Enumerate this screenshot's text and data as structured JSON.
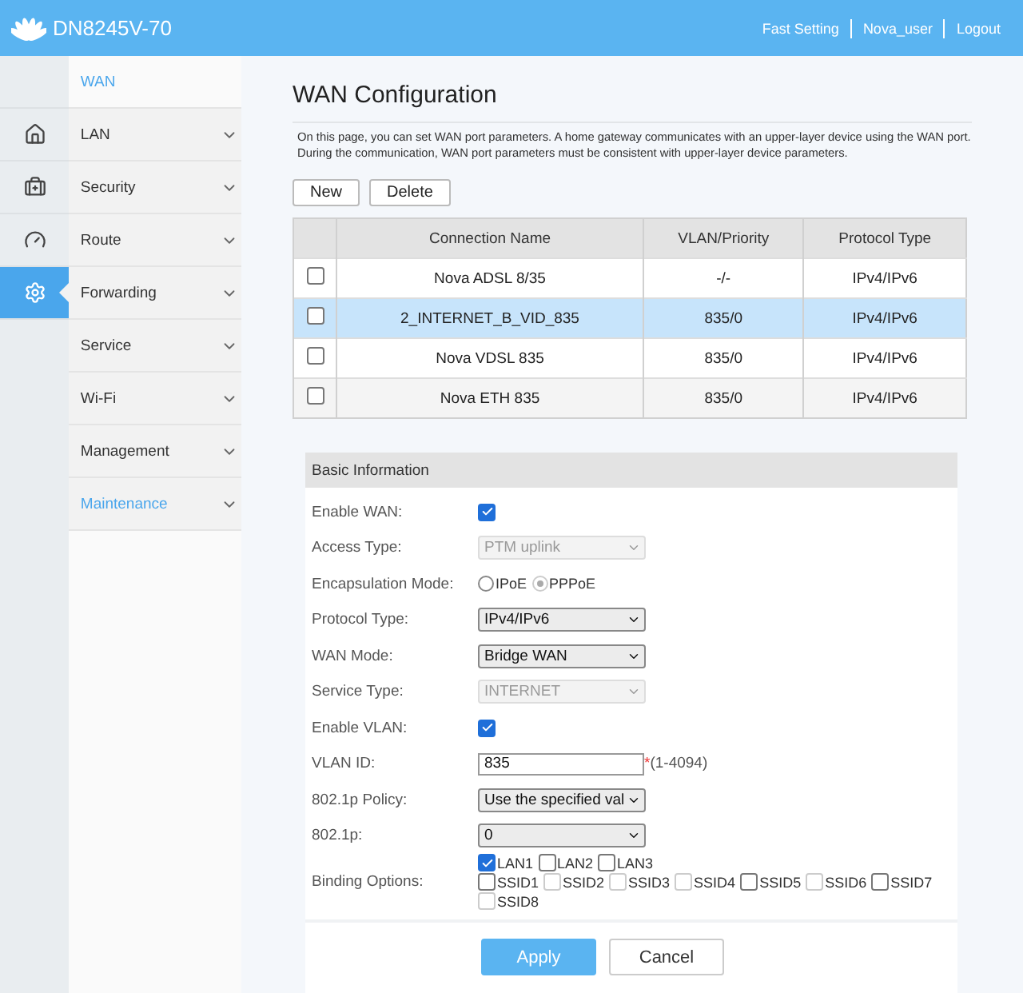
{
  "header": {
    "model": "DN8245V-70",
    "links": [
      "Fast Setting",
      "Nova_user",
      "Logout"
    ]
  },
  "rail": [
    {
      "selected": false
    },
    {
      "selected": false
    },
    {
      "selected": false
    },
    {
      "selected": false
    },
    {
      "selected": true
    }
  ],
  "sidebar": {
    "items": [
      {
        "label": "WAN",
        "kind": "sub",
        "highlighted": true
      },
      {
        "label": "LAN",
        "kind": "group",
        "highlighted": false
      },
      {
        "label": "Security",
        "kind": "group",
        "highlighted": false
      },
      {
        "label": "Route",
        "kind": "group",
        "highlighted": false
      },
      {
        "label": "Forwarding",
        "kind": "group",
        "highlighted": false
      },
      {
        "label": "Service",
        "kind": "group",
        "highlighted": false
      },
      {
        "label": "Wi-Fi",
        "kind": "group",
        "highlighted": false
      },
      {
        "label": "Management",
        "kind": "group",
        "highlighted": false
      },
      {
        "label": "Maintenance",
        "kind": "group",
        "highlighted": true
      }
    ]
  },
  "page": {
    "title": "WAN Configuration",
    "description": "On this page, you can set WAN port parameters. A home gateway communicates with an upper-layer device using the WAN port. During the communication, WAN port parameters must be consistent with upper-layer device parameters.",
    "buttons": [
      "New",
      "Delete"
    ]
  },
  "table": {
    "columns": [
      "Connection Name",
      "VLAN/Priority",
      "Protocol Type"
    ],
    "rows": [
      {
        "cells": [
          "Nova ADSL 8/35",
          "-/-",
          "IPv4/IPv6"
        ],
        "selected": false,
        "checked": false
      },
      {
        "cells": [
          "2_INTERNET_B_VID_835",
          "835/0",
          "IPv4/IPv6"
        ],
        "selected": true,
        "checked": false
      },
      {
        "cells": [
          "Nova VDSL 835",
          "835/0",
          "IPv4/IPv6"
        ],
        "selected": false,
        "checked": false
      },
      {
        "cells": [
          "Nova ETH 835",
          "835/0",
          "IPv4/IPv6"
        ],
        "selected": false,
        "checked": false
      }
    ]
  },
  "form": {
    "title": "Basic Information",
    "fields": [
      {
        "label": "Enable WAN:",
        "kind": "checkbox",
        "checked": true
      },
      {
        "label": "Access Type:",
        "kind": "select",
        "value": "PTM uplink",
        "disabled": true
      },
      {
        "label": "Encapsulation Mode:",
        "kind": "radio",
        "options": [
          {
            "label": "IPoE",
            "selected": false,
            "disabled": false
          },
          {
            "label": "PPPoE",
            "selected": true,
            "disabled": true
          }
        ]
      },
      {
        "label": "Protocol Type:",
        "kind": "select",
        "value": "IPv4/IPv6",
        "disabled": false
      },
      {
        "label": "WAN Mode:",
        "kind": "select",
        "value": "Bridge WAN",
        "disabled": false
      },
      {
        "label": "Service Type:",
        "kind": "select",
        "value": "INTERNET",
        "disabled": true
      },
      {
        "label": "Enable VLAN:",
        "kind": "checkbox",
        "checked": true
      },
      {
        "label": "VLAN ID:",
        "kind": "input",
        "value": "835",
        "required": "*",
        "hint": "(1-4094)"
      },
      {
        "label": "802.1p Policy:",
        "kind": "select",
        "value": "Use the specified val",
        "disabled": false
      },
      {
        "label": "802.1p:",
        "kind": "select",
        "value": "0",
        "disabled": false
      },
      {
        "label": "Binding Options:",
        "kind": "bindings",
        "groups": [
          [
            {
              "label": "LAN1",
              "checked": true,
              "disabled": false
            },
            {
              "label": "LAN2",
              "checked": false,
              "disabled": false
            },
            {
              "label": "LAN3",
              "checked": false,
              "disabled": false
            }
          ],
          [
            {
              "label": "SSID1",
              "checked": false,
              "disabled": false
            },
            {
              "label": "SSID2",
              "checked": false,
              "disabled": true
            },
            {
              "label": "SSID3",
              "checked": false,
              "disabled": true
            },
            {
              "label": "SSID4",
              "checked": false,
              "disabled": true
            },
            {
              "label": "SSID5",
              "checked": false,
              "disabled": false
            },
            {
              "label": "SSID6",
              "checked": false,
              "disabled": true
            },
            {
              "label": "SSID7",
              "checked": false,
              "disabled": false
            },
            {
              "label": "SSID8",
              "checked": false,
              "disabled": true
            }
          ]
        ]
      }
    ],
    "buttons": [
      {
        "label": "Apply",
        "kind": "primary"
      },
      {
        "label": "Cancel",
        "kind": "secondary"
      }
    ]
  }
}
